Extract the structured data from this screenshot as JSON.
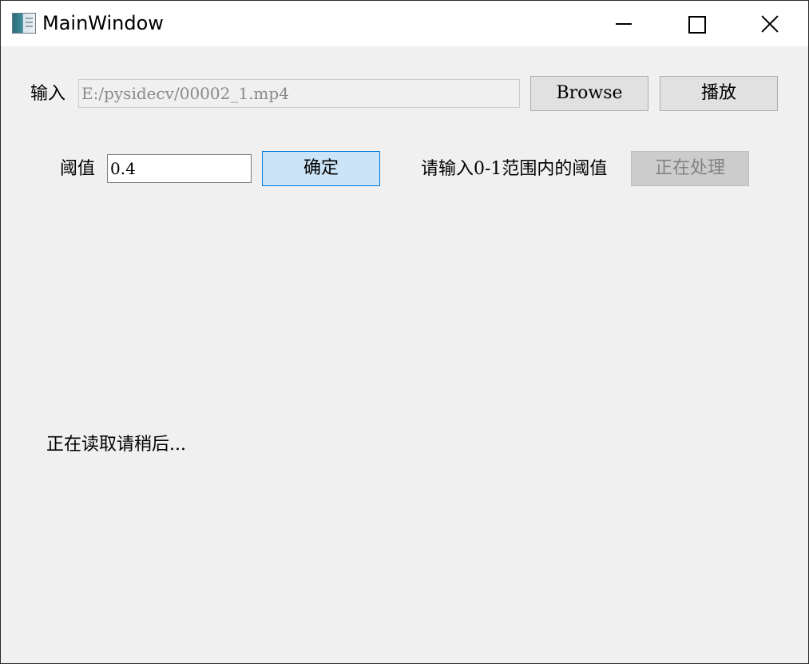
{
  "window": {
    "title": "MainWindow",
    "controls": {
      "minimize": "minimize-icon",
      "maximize": "maximize-icon",
      "close": "close-icon"
    }
  },
  "input_row": {
    "label": "输入",
    "path_value": "E:/pysidecv/00002_1.mp4",
    "browse_label": "Browse",
    "play_label": "播放"
  },
  "threshold_row": {
    "label": "阈值",
    "value": "0.4",
    "confirm_label": "确定",
    "hint": "请输入0-1范围内的阈值",
    "processing_label": "正在处理"
  },
  "status": {
    "text": "正在读取请稍后..."
  },
  "colors": {
    "window_bg": "#f0f0f0",
    "titlebar_bg": "#ffffff",
    "focus_accent": "#0078d7",
    "focus_fill": "#cce4f7"
  }
}
